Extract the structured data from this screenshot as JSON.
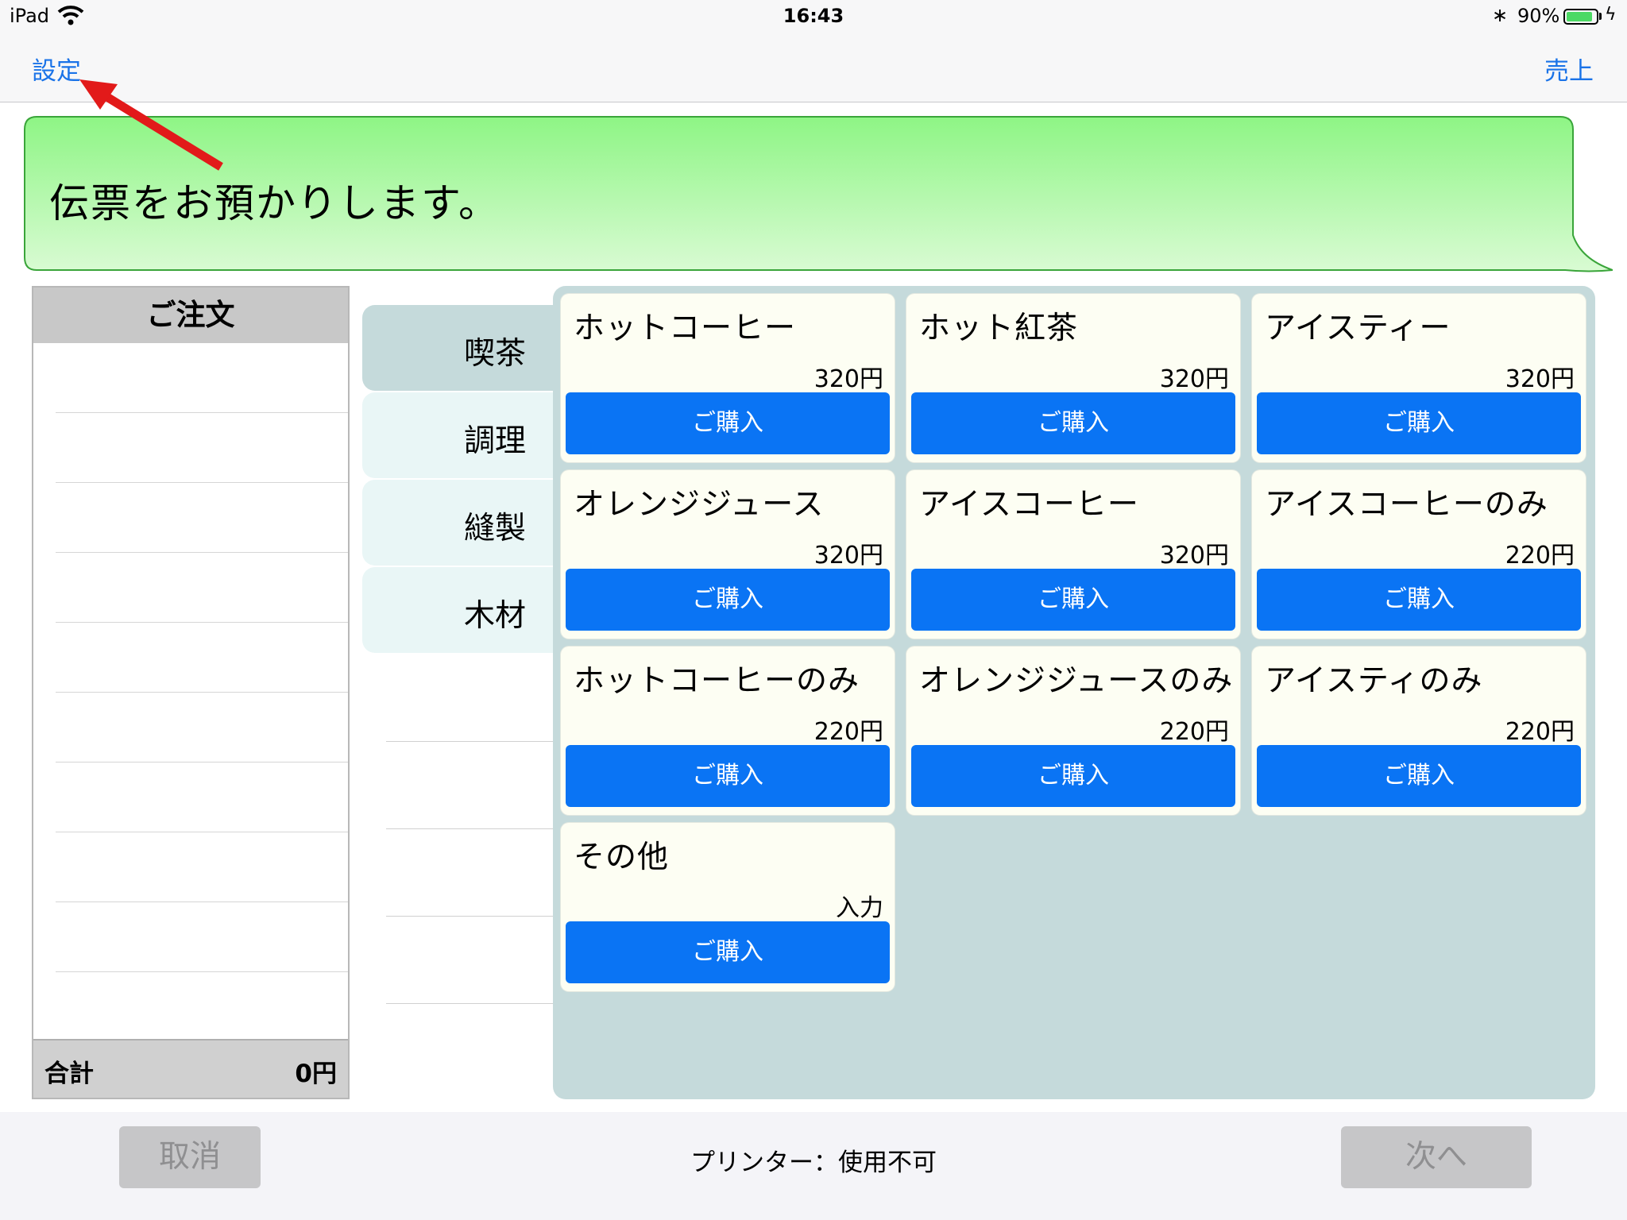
{
  "status_bar": {
    "device": "iPad",
    "time": "16:43",
    "bluetooth_glyph": "∗",
    "battery_percent": "90%",
    "battery_level": 0.9,
    "bolt_glyph": "ϟ"
  },
  "nav": {
    "settings_label": "設定",
    "sales_label": "売上"
  },
  "message": "伝票をお預かりします。",
  "order": {
    "header": "ご注文",
    "total_label": "合計",
    "total_value": "0円"
  },
  "categories": [
    {
      "label": "喫茶",
      "selected": true
    },
    {
      "label": "調理",
      "selected": false
    },
    {
      "label": "縫製",
      "selected": false
    },
    {
      "label": "木材",
      "selected": false
    }
  ],
  "products": [
    {
      "name": "ホットコーヒー",
      "price": "320円",
      "buy_label": "ご購入"
    },
    {
      "name": "ホット紅茶",
      "price": "320円",
      "buy_label": "ご購入"
    },
    {
      "name": "アイスティー",
      "price": "320円",
      "buy_label": "ご購入"
    },
    {
      "name": "オレンジジュース",
      "price": "320円",
      "buy_label": "ご購入"
    },
    {
      "name": "アイスコーヒー",
      "price": "320円",
      "buy_label": "ご購入"
    },
    {
      "name": "アイスコーヒーのみ",
      "price": "220円",
      "buy_label": "ご購入"
    },
    {
      "name": "ホットコーヒーのみ",
      "price": "220円",
      "buy_label": "ご購入"
    },
    {
      "name": "オレンジジュースのみ",
      "price": "220円",
      "buy_label": "ご購入"
    },
    {
      "name": "アイスティのみ",
      "price": "220円",
      "buy_label": "ご購入"
    },
    {
      "name": "その他",
      "price": "入力",
      "buy_label": "ご購入"
    }
  ],
  "toolbar": {
    "cancel_label": "取消",
    "printer_status": "プリンター：使用不可",
    "next_label": "次へ"
  },
  "colors": {
    "accent_blue": "#0a74f4",
    "link_blue": "#1a73e8",
    "bubble_green_top": "#8ef585",
    "bubble_green_bottom": "#d9fbd3",
    "grid_bg": "#c5dadb",
    "tab_selected": "#c5dadb",
    "tab_unselected": "#e9f6f6",
    "annotation_red": "#e21a1a"
  },
  "icons": {
    "wifi": "wifi-icon",
    "bluetooth": "bluetooth-icon",
    "battery": "battery-icon",
    "charging": "charging-bolt-icon",
    "annotation": "red-arrow-annotation-icon"
  }
}
